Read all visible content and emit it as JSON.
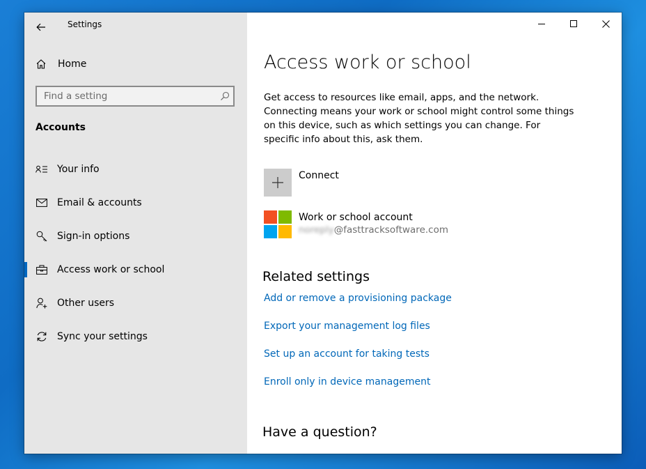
{
  "window": {
    "app_title": "Settings",
    "controls": {
      "minimize": "minimize-icon",
      "maximize": "maximize-icon",
      "close": "close-icon"
    }
  },
  "sidebar": {
    "home_label": "Home",
    "search": {
      "placeholder": "Find a setting"
    },
    "section_title": "Accounts",
    "items": [
      {
        "label": "Your info",
        "icon": "contact-card-icon"
      },
      {
        "label": "Email & accounts",
        "icon": "mail-icon"
      },
      {
        "label": "Sign-in options",
        "icon": "key-icon"
      },
      {
        "label": "Access work or school",
        "icon": "briefcase-icon",
        "active": true
      },
      {
        "label": "Other users",
        "icon": "add-person-icon"
      },
      {
        "label": "Sync your settings",
        "icon": "sync-icon"
      }
    ]
  },
  "main": {
    "title": "Access work or school",
    "description": "Get access to resources like email, apps, and the network. Connecting means your work or school might control some things on this device, such as which settings you can change. For specific info about this, ask them.",
    "connect_label": "Connect",
    "account": {
      "name": "Work or school account",
      "email_user": "noreply",
      "email_domain": "@fasttracksoftware.com"
    },
    "related_title": "Related settings",
    "related_links": [
      "Add or remove a provisioning package",
      "Export your management log files",
      "Set up an account for taking tests",
      "Enroll only in device management"
    ],
    "question_title": "Have a question?"
  },
  "colors": {
    "accent": "#0067c0",
    "link": "#0067b8",
    "sidebar_bg": "#e6e6e6",
    "ms_red": "#f25022",
    "ms_green": "#7fba00",
    "ms_blue": "#00a4ef",
    "ms_yellow": "#ffb900"
  }
}
